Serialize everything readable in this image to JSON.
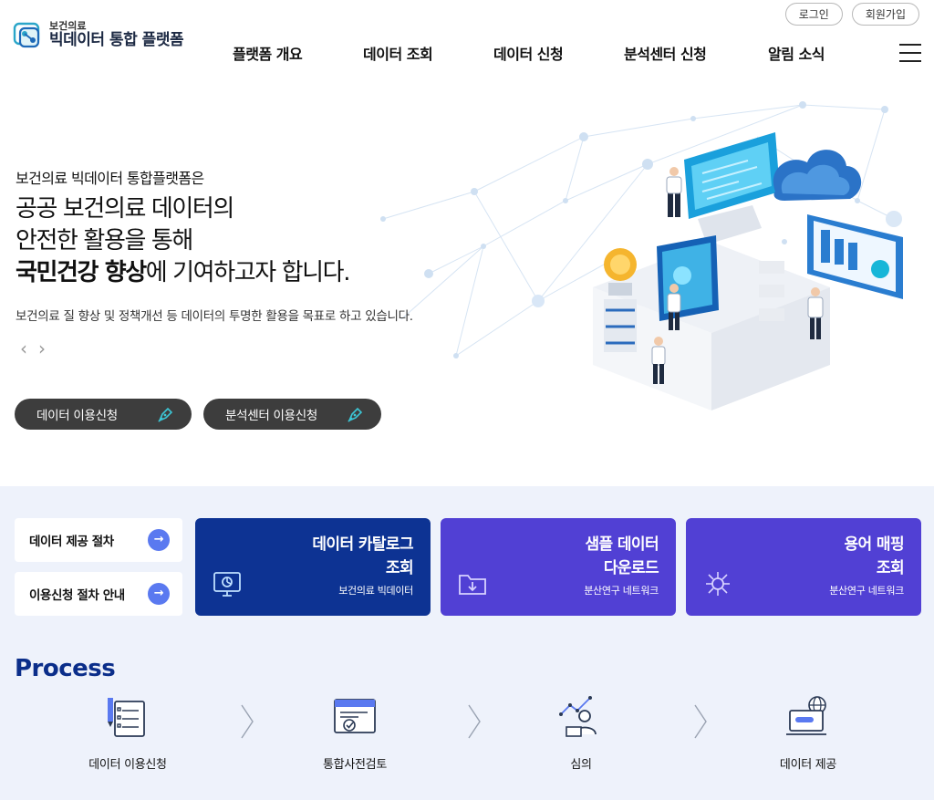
{
  "header": {
    "logo_small": "보건의료",
    "logo_big": "빅데이터 통합 플랫폼",
    "login": "로그인",
    "signup": "회원가입",
    "menu_icon": "hamburger-icon",
    "nav": [
      "플랫폼 개요",
      "데이터 조회",
      "데이터 신청",
      "분석센터 신청",
      "알림 소식"
    ]
  },
  "hero": {
    "kicker": "보건의료 빅데이터 통합플랫폼은",
    "line1": "공공 보건의료 데이터의",
    "line2": "안전한 활용을 통해",
    "line3_strong": "국민건강 향상",
    "line3_rest": "에 기여하고자 합니다.",
    "description": "보건의료 질 향상 및 정책개선 등 데이터의 투명한 활용을 목표로 하고 있습니다.",
    "prev_icon": "chevron-left-icon",
    "next_icon": "chevron-right-icon",
    "btn_data": "데이터 이용신청",
    "btn_center": "분석센터 이용신청"
  },
  "quick": {
    "side_links": [
      "데이터 제공 절차",
      "이용신청 절차 안내"
    ],
    "cards": [
      {
        "title1": "데이터 카탈로그",
        "title2": "조회",
        "sub": "보건의료 빅데이터",
        "color": "#0d3393"
      },
      {
        "title1": "샘플 데이터",
        "title2": "다운로드",
        "sub": "분산연구 네트워크",
        "color": "#5140d4"
      },
      {
        "title1": "용어 매핑",
        "title2": "조회",
        "sub": "분산연구 네트워크",
        "color": "#5140d4"
      }
    ]
  },
  "process": {
    "title": "Process",
    "steps": [
      "데이터 이용신청",
      "통합사전검토",
      "심의",
      "데이터 제공"
    ]
  },
  "colors": {
    "accent": "#0b2e8a",
    "hero_button": "#3d3d3d",
    "go_button": "#5a79f0",
    "section_bg": "#eef2fb"
  }
}
